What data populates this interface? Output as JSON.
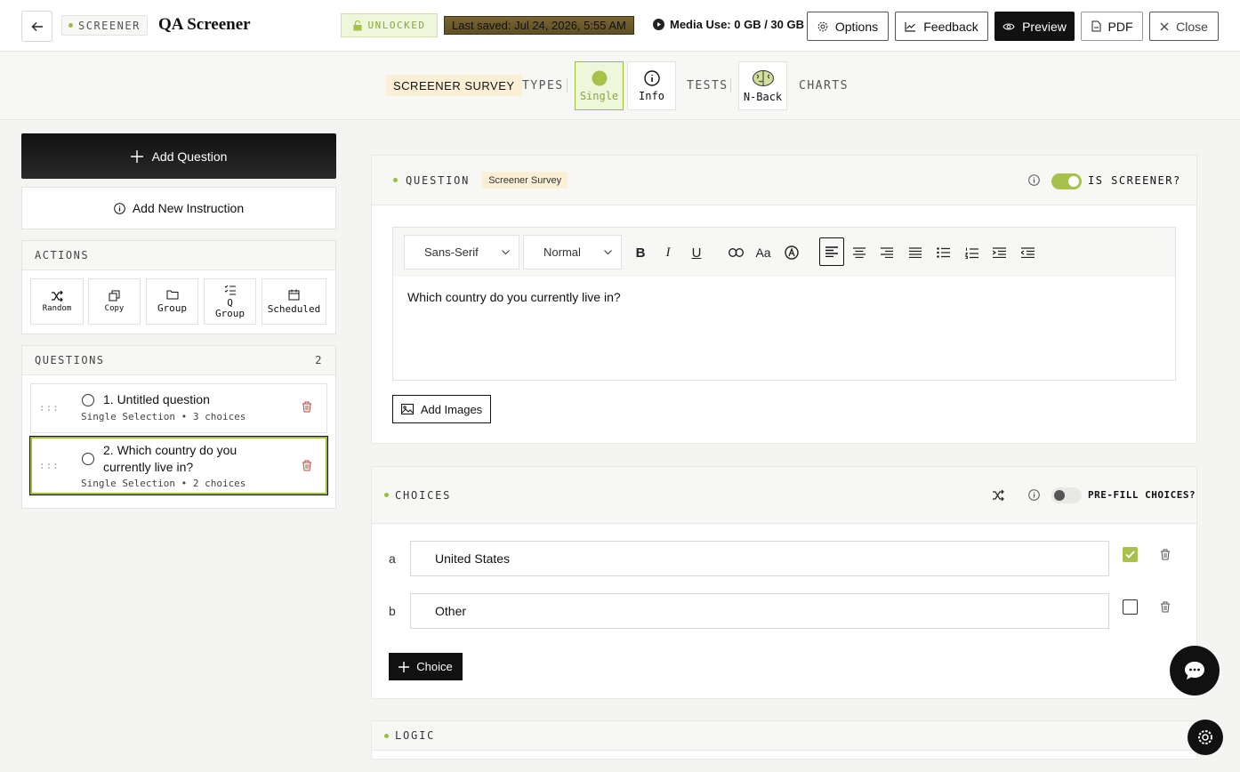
{
  "header": {
    "tag": "SCREENER",
    "title": "QA Screener",
    "lock_status": "UNLOCKED",
    "last_saved": "Last saved: Jul 24, 2026, 5:55 AM",
    "media_use": "Media Use: 0 GB / 30 GB",
    "buttons": {
      "options": "Options",
      "feedback": "Feedback",
      "preview": "Preview",
      "pdf": "PDF",
      "close": "Close"
    }
  },
  "tabs": {
    "active": "SCREENER SURVEY",
    "types": "TYPES",
    "single": "Single",
    "info": "Info",
    "tests": "TESTS",
    "nback": "N-Back",
    "charts": "CHARTS"
  },
  "sidebar": {
    "add_question": "Add Question",
    "add_instruction": "Add New Instruction",
    "actions_title": "ACTIONS",
    "actions": [
      {
        "label": "Random",
        "icon": "shuffle-icon"
      },
      {
        "label": "Copy",
        "icon": "copy-icon"
      },
      {
        "label": "Group",
        "icon": "folder-icon"
      },
      {
        "label": "Q\nGroup",
        "icon": "checklist-icon"
      },
      {
        "label": "Scheduled",
        "icon": "calendar-icon"
      }
    ],
    "questions_title": "QUESTIONS",
    "questions_count": "2",
    "questions": [
      {
        "title": "1. Untitled question",
        "sub": "Single Selection • 3 choices",
        "selected": false
      },
      {
        "title": "2. Which country do you currently live in?",
        "sub": "Single Selection • 2 choices",
        "selected": true
      }
    ]
  },
  "question": {
    "label": "QUESTION",
    "badge": "Screener Survey",
    "screener_label": "IS SCREENER?",
    "screener_on": true,
    "font_select": "Sans-Serif",
    "size_select": "Normal",
    "body": "Which country do you currently live in?",
    "add_images": "Add Images"
  },
  "choices": {
    "label": "CHOICES",
    "prefill_label": "PRE-FILL CHOICES?",
    "prefill_on": false,
    "items": [
      {
        "letter": "a",
        "text": "United States",
        "checked": true
      },
      {
        "letter": "b",
        "text": "Other",
        "checked": false
      }
    ],
    "add_label": "Choice"
  },
  "logic": {
    "label": "LOGIC"
  },
  "colors": {
    "accent": "#a6c24a",
    "badge_bg": "#fbf0d6",
    "dark": "#111111"
  }
}
